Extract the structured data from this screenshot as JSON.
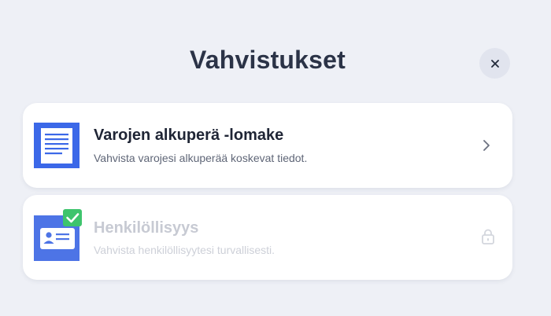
{
  "modal": {
    "title": "Vahvistukset"
  },
  "cards": [
    {
      "title": "Varojen alkuperä -lomake",
      "subtitle": "Vahvista varojesi alkuperää koskevat tiedot.",
      "icon": "document-icon",
      "state": "available"
    },
    {
      "title": "Henkilöllisyys",
      "subtitle": "Vahvista henkilöllisyytesi turvallisesti.",
      "icon": "id-card-icon",
      "state": "locked"
    }
  ],
  "colors": {
    "background": "#eef0f6",
    "accent": "#3b68e8",
    "check": "#3ec46d",
    "title": "#2b3347"
  }
}
